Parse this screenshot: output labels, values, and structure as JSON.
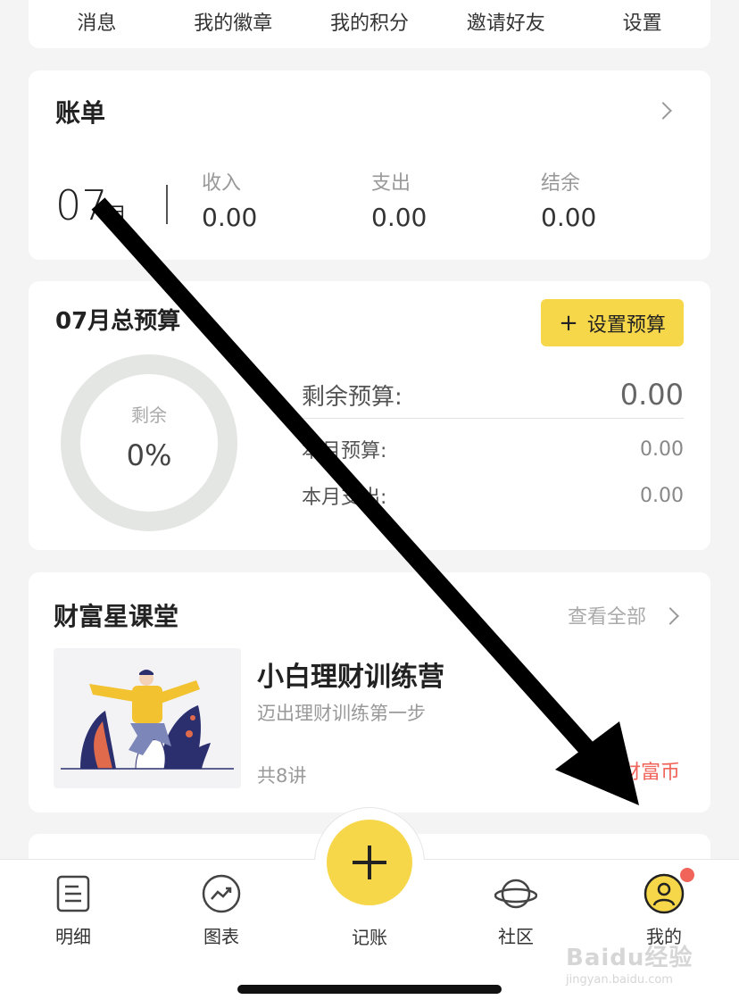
{
  "top_menu": {
    "items": [
      "消息",
      "我的徽章",
      "我的积分",
      "邀请好友",
      "设置"
    ]
  },
  "bill": {
    "title": "账单",
    "month": "07",
    "month_unit": "月",
    "stats": [
      {
        "label": "收入",
        "value": "0.00"
      },
      {
        "label": "支出",
        "value": "0.00"
      },
      {
        "label": "结余",
        "value": "0.00"
      }
    ]
  },
  "budget": {
    "title": "07月总预算",
    "button_label": "设置预算",
    "ring_label": "剩余",
    "ring_percent": "0%",
    "remaining_label": "剩余预算:",
    "remaining_value": "0.00",
    "month_budget_label": "本月预算:",
    "month_budget_value": "0.00",
    "month_spend_label": "本月支出:",
    "month_spend_value": "0.00"
  },
  "classroom": {
    "title": "财富星课堂",
    "see_all": "查看全部",
    "course": {
      "title": "小白理财训练营",
      "subtitle": "迈出理财训练第一步",
      "count": "共8讲",
      "price": "财富币"
    }
  },
  "tabbar": {
    "tabs": [
      {
        "label": "明细",
        "icon": "list-icon"
      },
      {
        "label": "图表",
        "icon": "trend-chart-icon"
      },
      {
        "label": "记账",
        "icon": "plus-icon"
      },
      {
        "label": "社区",
        "icon": "planet-icon"
      },
      {
        "label": "我的",
        "icon": "user-icon"
      }
    ],
    "active_badge_color": "#f0645a"
  },
  "colors": {
    "accent_yellow": "#f7d74a",
    "price_red": "#f0645a",
    "background": "#f4f4f4"
  },
  "watermark": {
    "brand": "Baidu经验",
    "url": "jingyan.baidu.com"
  }
}
